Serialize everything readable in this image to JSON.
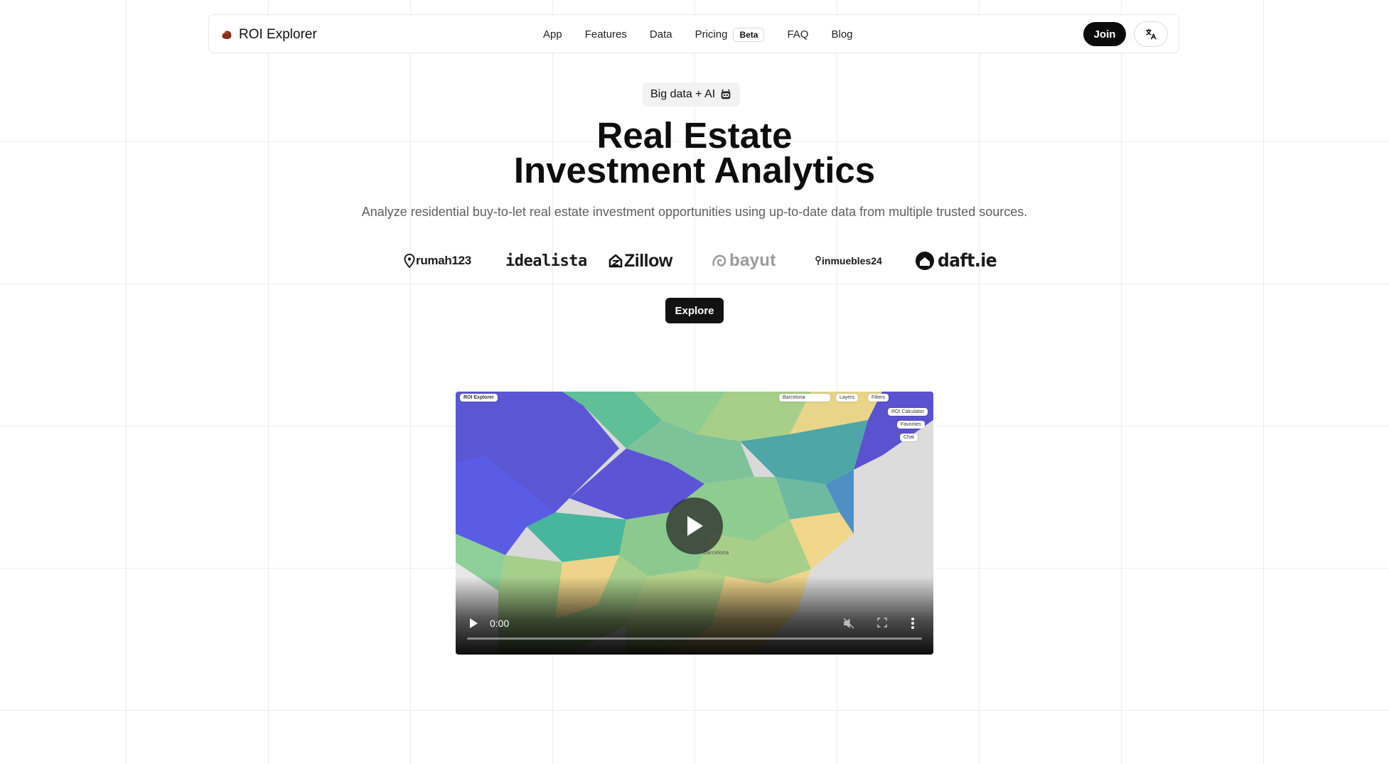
{
  "brand": {
    "name": "ROI Explorer"
  },
  "nav": {
    "links": [
      "App",
      "Features",
      "Data",
      "Pricing",
      "FAQ",
      "Blog"
    ],
    "beta_badge": "Beta",
    "join_label": "Join",
    "language_icon": "translate-icon"
  },
  "hero": {
    "badge_text": "Big data + AI",
    "badge_icon": "robot-face-icon",
    "title_line1": "Real Estate",
    "title_line2": "Investment Analytics",
    "subtitle": "Analyze residential buy-to-let real estate investment opportunities using up-to-date data from multiple trusted sources.",
    "sources": [
      "rumah123",
      "idealista",
      "Zillow",
      "bayut",
      "inmuebles24",
      "daft.ie"
    ],
    "explore_label": "Explore"
  },
  "video": {
    "current_time": "0:00",
    "progress": 0,
    "muted": true,
    "preview": {
      "app_name": "ROI Explorer",
      "city": "Barcelona",
      "toolbar": [
        "Layers",
        "Filters",
        "ROI Calculator",
        "Favorites",
        "Chat"
      ],
      "district_label": "Barcelona"
    }
  },
  "colors": {
    "accent": "#0b0b0b",
    "muted_text": "#5f5f5f"
  }
}
